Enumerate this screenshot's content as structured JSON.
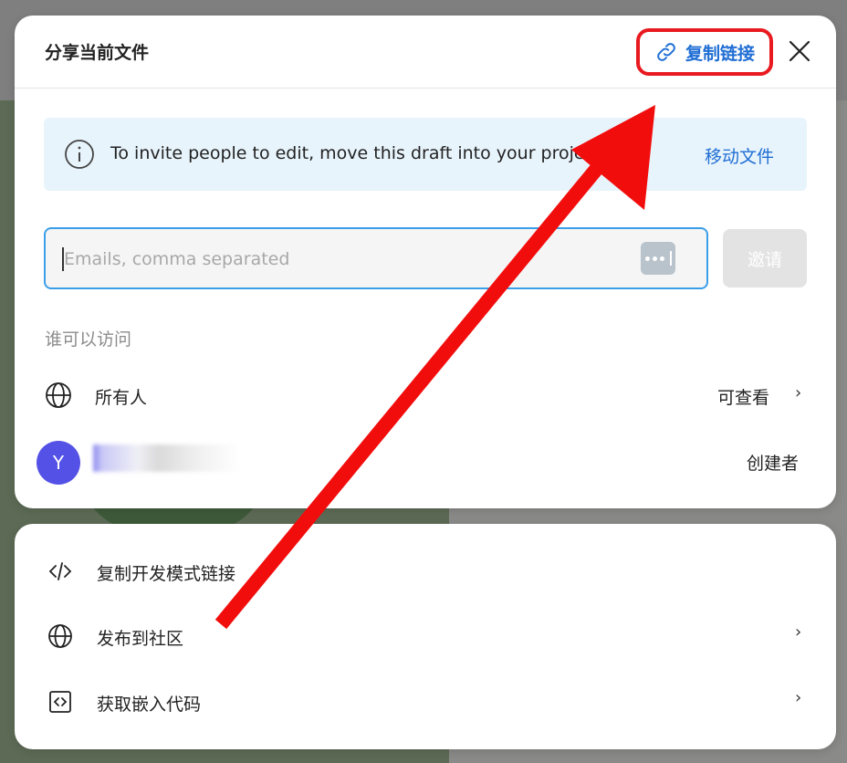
{
  "share": {
    "title": "分享当前文件",
    "copy_link_label": "复制链接",
    "banner_text": "To invite people to edit, move this draft into your projects.",
    "move_file_label": "移动文件",
    "email_placeholder": "Emails, comma separated",
    "invite_label": "邀请",
    "access_label": "谁可以访问",
    "everyone_label": "所有人",
    "everyone_permission": "可查看",
    "owner_avatar_letter": "Y",
    "owner_role": "创建者"
  },
  "menu": {
    "items": [
      {
        "label": "复制开发模式链接",
        "icon": "code-icon"
      },
      {
        "label": "发布到社区",
        "icon": "globe-icon"
      },
      {
        "label": "获取嵌入代码",
        "icon": "embed-icon"
      }
    ]
  },
  "colors": {
    "accent": "#1f6ed4",
    "highlight_red": "#e8191f",
    "avatar": "#5451e6",
    "banner_bg": "#e8f4fc"
  }
}
